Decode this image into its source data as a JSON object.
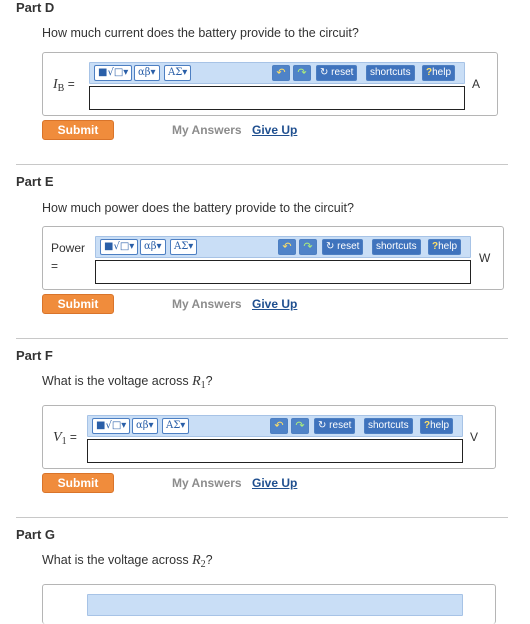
{
  "toolbar": {
    "templates_label": "■√□",
    "greek_label": "αβ",
    "symbols_label": "ΑΣ",
    "undo_icon": "↶",
    "redo_icon": "↷",
    "reset_label": "reset",
    "shortcuts_label": "shortcuts",
    "help_label": "help",
    "help_mark": "?"
  },
  "actions": {
    "submit_label": "Submit",
    "my_answers_label": "My Answers",
    "give_up_label": "Give Up"
  },
  "parts": [
    {
      "title": "Part D",
      "question": "How much current does the battery provide to the circuit?",
      "lhs_var": "I",
      "lhs_sub": "B",
      "lhs_eq": "=",
      "unit": "A"
    },
    {
      "title": "Part E",
      "question": "How much power does the battery provide to the circuit?",
      "lhs_text": "Power",
      "lhs_eq": "=",
      "unit": "W"
    },
    {
      "title": "Part F",
      "question_prefix": "What is the voltage across ",
      "q_var": "R",
      "q_sub": "1",
      "q_suffix": "?",
      "lhs_var": "V",
      "lhs_sub": "1",
      "lhs_eq": "=",
      "unit": "V"
    },
    {
      "title": "Part G",
      "question_prefix": "What is the voltage across ",
      "q_var": "R",
      "q_sub": "2",
      "q_suffix": "?"
    }
  ]
}
